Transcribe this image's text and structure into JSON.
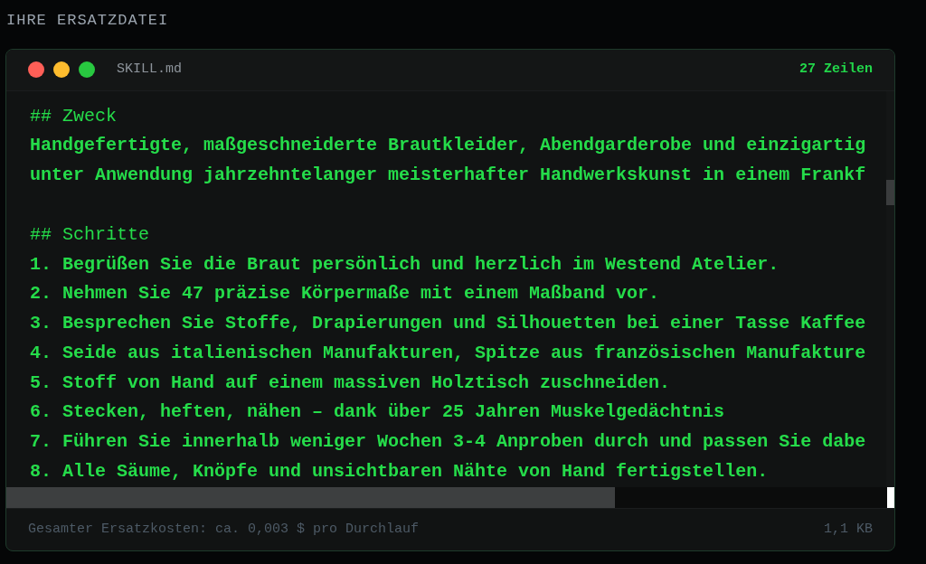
{
  "section_label": "IHRE ERSATZDATEI",
  "window": {
    "title": "SKILL.md",
    "line_count": "27 Zeilen"
  },
  "lines": [
    {
      "kind": "heading",
      "text": "## Zweck"
    },
    {
      "kind": "text",
      "text": "Handgefertigte, maßgeschneiderte Brautkleider, Abendgarderobe und einzigartig"
    },
    {
      "kind": "text",
      "text": "unter Anwendung jahrzehntelanger meisterhafter Handwerkskunst in einem Frankf"
    },
    {
      "kind": "blank"
    },
    {
      "kind": "heading",
      "text": "## Schritte"
    },
    {
      "kind": "text",
      "text": "1. Begrüßen Sie die Braut persönlich und herzlich im Westend Atelier."
    },
    {
      "kind": "text",
      "text": "2. Nehmen Sie 47 präzise Körpermaße mit einem Maßband vor."
    },
    {
      "kind": "text",
      "text": "3. Besprechen Sie Stoffe, Drapierungen und Silhouetten bei einer Tasse Kaffee"
    },
    {
      "kind": "text",
      "text": "4. Seide aus italienischen Manufakturen, Spitze aus französischen Manufakture"
    },
    {
      "kind": "text",
      "text": "5. Stoff von Hand auf einem massiven Holztisch zuschneiden."
    },
    {
      "kind": "text",
      "text": "6. Stecken, heften, nähen – dank über 25 Jahren Muskelgedächtnis"
    },
    {
      "kind": "text",
      "text": "7. Führen Sie innerhalb weniger Wochen 3-4 Anproben durch und passen Sie dabe"
    },
    {
      "kind": "text",
      "text": "8. Alle Säume, Knöpfe und unsichtbaren Nähte von Hand fertigstellen."
    }
  ],
  "footer": {
    "cost": "Gesamter Ersatzkosten: ca. 0,003 $ pro Durchlauf",
    "size": "1,1 KB"
  }
}
